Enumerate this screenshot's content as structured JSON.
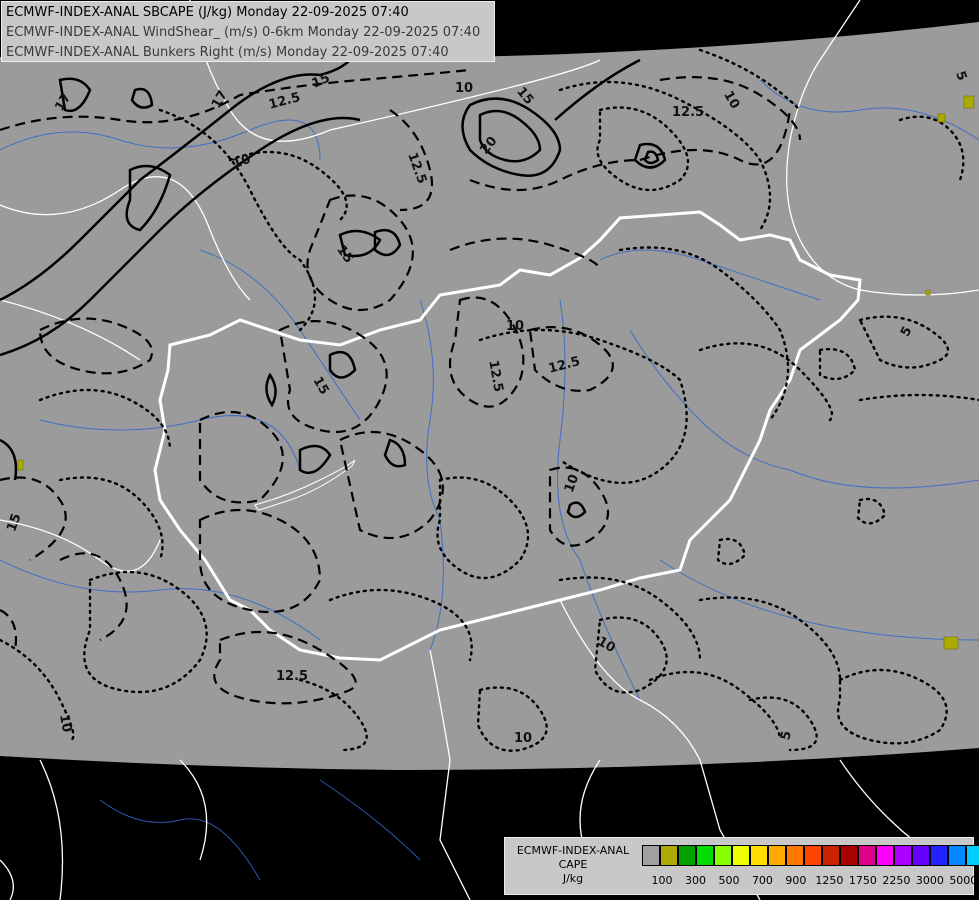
{
  "header": {
    "lines": [
      "ECMWF-INDEX-ANAL SBCAPE (J/kg) Monday 22-09-2025 07:40",
      "ECMWF-INDEX-ANAL WindShear_ (m/s) 0-6km Monday 22-09-2025 07:40",
      "ECMWF-INDEX-ANAL Bunkers Right (m/s) Monday 22-09-2025 07:40"
    ]
  },
  "legend": {
    "title": "ECMWF-INDEX-ANAL",
    "field": "CAPE",
    "unit": "J/kg",
    "colors": [
      "#a0a0a0",
      "#aaaa00",
      "#00a000",
      "#00dd00",
      "#88ff00",
      "#eeff00",
      "#ffdd00",
      "#ffaa00",
      "#ff7700",
      "#ff4400",
      "#cc2200",
      "#aa0000",
      "#dd0088",
      "#ff00ff",
      "#aa00ff",
      "#6600ff",
      "#2222ff",
      "#0088ff",
      "#00ccff",
      "#55ffff",
      "#ffffff"
    ],
    "tick_labels": [
      "100",
      "300",
      "500",
      "700",
      "900",
      "1250",
      "1750",
      "2250",
      "3000",
      "5000"
    ]
  },
  "map": {
    "contour_labels": [
      "17",
      "15",
      "12.5",
      "10",
      "20",
      "5",
      "12.5",
      "10",
      "12.5",
      "15",
      "10",
      "12.5",
      "15",
      "10",
      "12.5",
      "10",
      "5",
      "10",
      "15",
      "10",
      "5",
      "15",
      "17",
      "12.5",
      "10"
    ],
    "colors": {
      "land": "#9b9b9b",
      "outside": "#000000",
      "border": "#ffffff",
      "national_border": "#ffffff",
      "river": "#3366cc",
      "contour": "#000000",
      "cape_low": "#aaaa00"
    }
  }
}
